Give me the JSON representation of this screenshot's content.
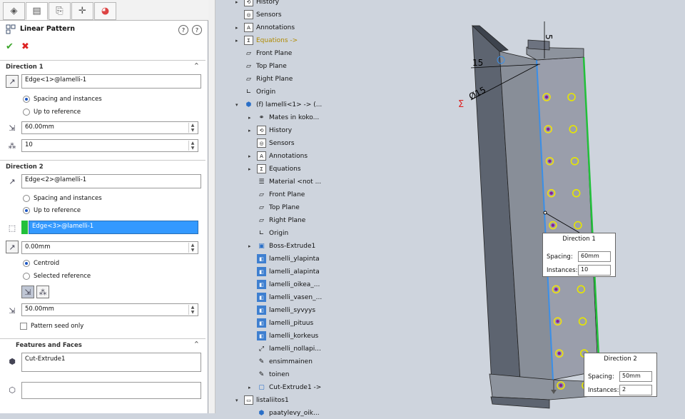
{
  "panel": {
    "title": "Linear Pattern",
    "help1": "?",
    "help2": "?",
    "tabs": [
      "feature-manager",
      "property-manager",
      "configuration-manager",
      "dimxpert",
      "display-manager"
    ],
    "direction1": {
      "header": "Direction 1",
      "edge": "Edge<1>@lamelli-1",
      "radio_spacing": "Spacing and instances",
      "radio_upto": "Up to reference",
      "spacing": "60.00mm",
      "instances": "10"
    },
    "direction2": {
      "header": "Direction 2",
      "edge": "Edge<2>@lamelli-1",
      "radio_spacing": "Spacing and instances",
      "radio_upto": "Up to reference",
      "reference": "Edge<3>@lamelli-1",
      "offset": "0.00mm",
      "radio_centroid": "Centroid",
      "radio_selected": "Selected reference",
      "spacing": "50.00mm",
      "seed_only": "Pattern seed only"
    },
    "features": {
      "header": "Features and Faces",
      "list": "Cut-Extrude1",
      "faces": ""
    }
  },
  "tree": [
    {
      "label": "History",
      "icon": "history-icon",
      "depth": 0,
      "arrow": "▸"
    },
    {
      "label": "Sensors",
      "icon": "sensor-icon",
      "depth": 0,
      "arrow": ""
    },
    {
      "label": "Annotations",
      "icon": "annotations-icon",
      "depth": 0,
      "arrow": "▸"
    },
    {
      "label": "Equations ->",
      "icon": "equations-icon",
      "depth": 0,
      "arrow": "▸"
    },
    {
      "label": "Front Plane",
      "icon": "plane-icon",
      "depth": 0,
      "arrow": ""
    },
    {
      "label": "Top Plane",
      "icon": "plane-icon",
      "depth": 0,
      "arrow": ""
    },
    {
      "label": "Right Plane",
      "icon": "plane-icon",
      "depth": 0,
      "arrow": ""
    },
    {
      "label": "Origin",
      "icon": "origin-icon",
      "depth": 0,
      "arrow": ""
    },
    {
      "label": "(f) lamelli<1> -> (...",
      "icon": "part-icon",
      "depth": 0,
      "arrow": "▾"
    },
    {
      "label": "Mates in koko...",
      "icon": "mates-icon",
      "depth": 1,
      "arrow": "▸"
    },
    {
      "label": "History",
      "icon": "history-icon",
      "depth": 1,
      "arrow": "▸"
    },
    {
      "label": "Sensors",
      "icon": "sensor-icon",
      "depth": 1,
      "arrow": ""
    },
    {
      "label": "Annotations",
      "icon": "annotations-icon",
      "depth": 1,
      "arrow": "▸"
    },
    {
      "label": "Equations",
      "icon": "equations-icon",
      "depth": 1,
      "arrow": "▸"
    },
    {
      "label": "Material <not ...",
      "icon": "material-icon",
      "depth": 1,
      "arrow": ""
    },
    {
      "label": "Front Plane",
      "icon": "plane-icon",
      "depth": 1,
      "arrow": ""
    },
    {
      "label": "Top Plane",
      "icon": "plane-icon",
      "depth": 1,
      "arrow": ""
    },
    {
      "label": "Right Plane",
      "icon": "plane-icon",
      "depth": 1,
      "arrow": ""
    },
    {
      "label": "Origin",
      "icon": "origin-icon",
      "depth": 1,
      "arrow": ""
    },
    {
      "label": "Boss-Extrude1",
      "icon": "extrude-icon",
      "depth": 1,
      "arrow": "▸"
    },
    {
      "label": "lamelli_ylapinta",
      "icon": "surface-icon",
      "depth": 1,
      "arrow": ""
    },
    {
      "label": "lamelli_alapinta",
      "icon": "surface-icon",
      "depth": 1,
      "arrow": ""
    },
    {
      "label": "lamelli_oikea_...",
      "icon": "surface-icon",
      "depth": 1,
      "arrow": ""
    },
    {
      "label": "lamelli_vasen_...",
      "icon": "surface-icon",
      "depth": 1,
      "arrow": ""
    },
    {
      "label": "lamelli_syvyys",
      "icon": "surface-icon",
      "depth": 1,
      "arrow": ""
    },
    {
      "label": "lamelli_pituus",
      "icon": "surface-icon",
      "depth": 1,
      "arrow": ""
    },
    {
      "label": "lamelli_korkeus",
      "icon": "surface-icon",
      "depth": 1,
      "arrow": ""
    },
    {
      "label": "lamelli_nollapi...",
      "icon": "coordinate-icon",
      "depth": 1,
      "arrow": ""
    },
    {
      "label": "ensimmainen",
      "icon": "sketch-icon",
      "depth": 1,
      "arrow": ""
    },
    {
      "label": "toinen",
      "icon": "sketch-icon",
      "depth": 1,
      "arrow": ""
    },
    {
      "label": "Cut-Extrude1 ->",
      "icon": "cut-icon",
      "depth": 1,
      "arrow": "▸"
    },
    {
      "label": "listaliitos1",
      "icon": "folder-icon",
      "depth": 0,
      "arrow": "▾"
    },
    {
      "label": "paatylevy_oik...",
      "icon": "part-icon",
      "depth": 1,
      "arrow": ""
    }
  ],
  "viewport": {
    "dim_top": "5",
    "dim_left": "15",
    "dim_dia": "Ø15",
    "callout1": {
      "title": "Direction 1",
      "spacing_label": "Spacing:",
      "spacing": "60mm",
      "instances_label": "Instances:",
      "instances": "10"
    },
    "callout2": {
      "title": "Direction 2",
      "spacing_label": "Spacing:",
      "spacing": "50mm",
      "instances_label": "Instances:",
      "instances": "2"
    }
  }
}
